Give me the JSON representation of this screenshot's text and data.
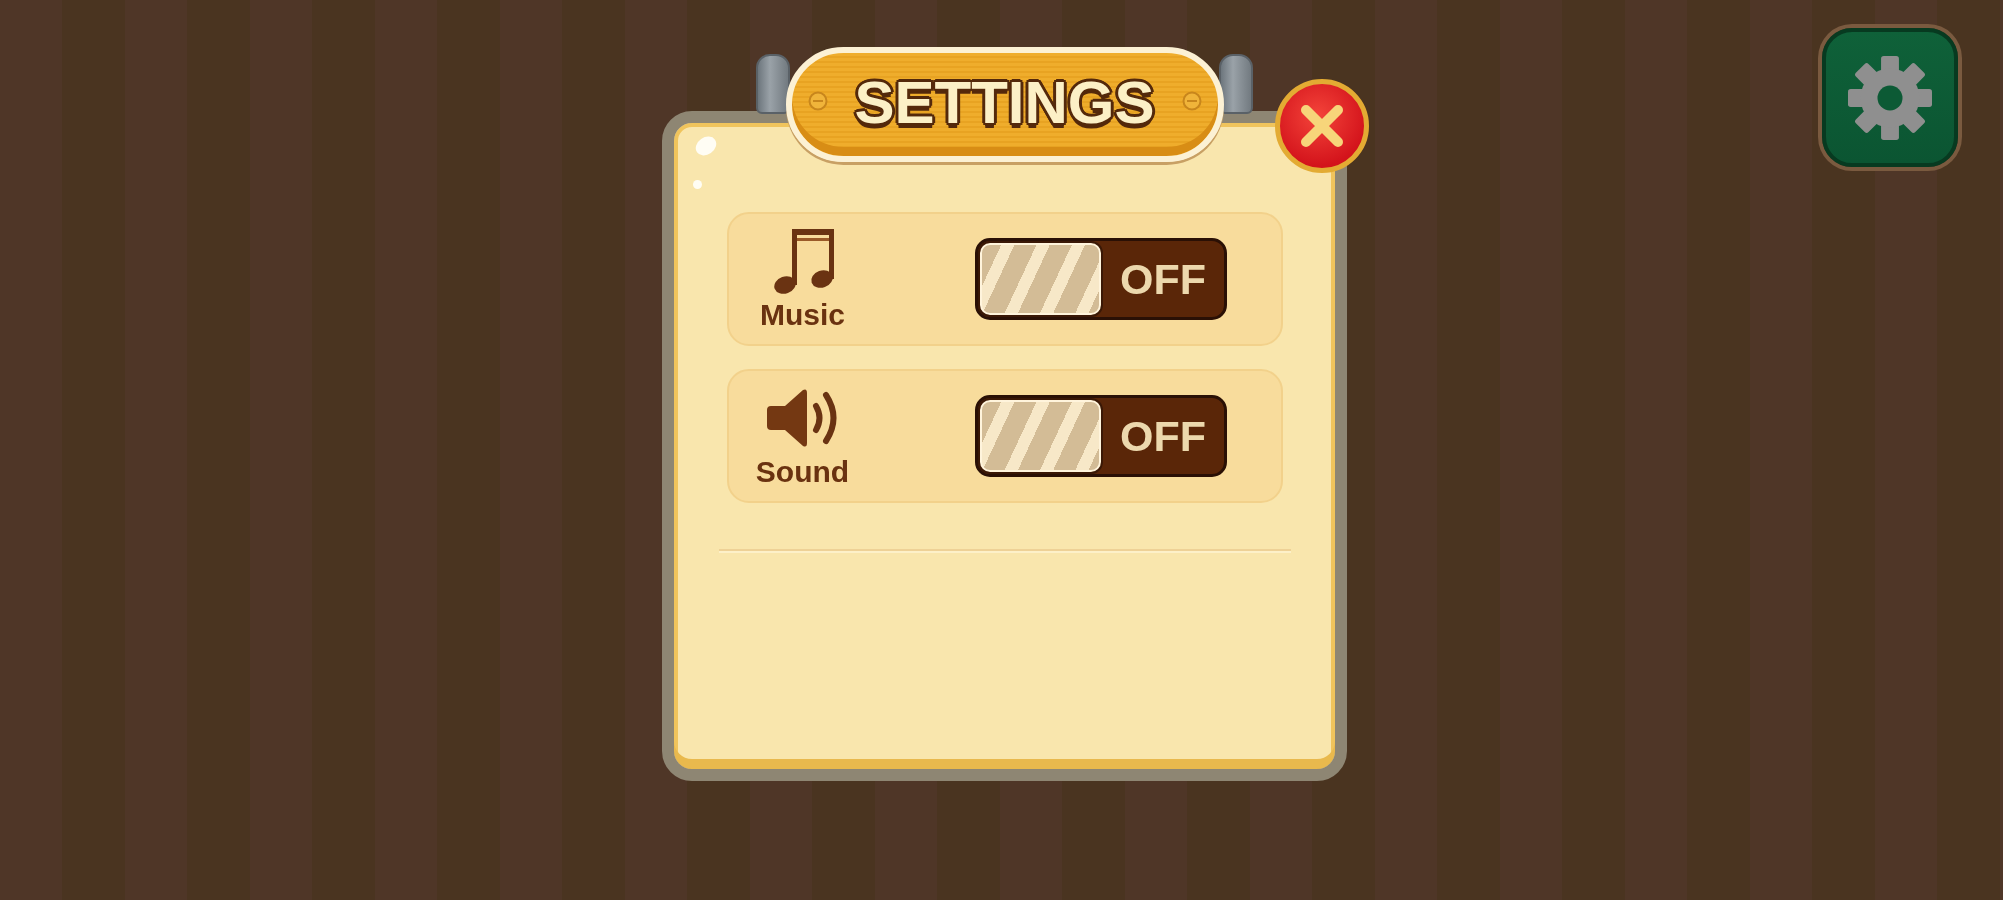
{
  "dialog": {
    "title": "SETTINGS"
  },
  "settings": [
    {
      "kind": "music",
      "label": "Music",
      "on": false,
      "state_label": "OFF"
    },
    {
      "kind": "sound",
      "label": "Sound",
      "on": false,
      "state_label": "OFF"
    }
  ]
}
